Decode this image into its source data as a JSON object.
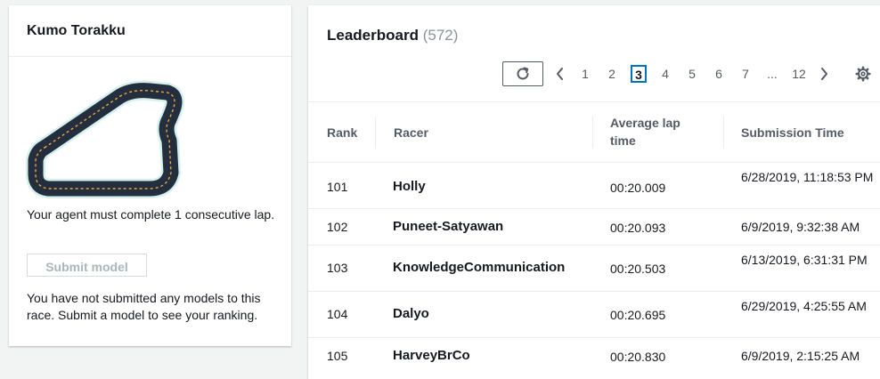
{
  "race": {
    "title": "Kumo Torakku",
    "requirement_text": "Your agent must complete 1 consecutive lap.",
    "submit_label": "Submit model",
    "notice_text": "You have not submitted any models to this race. Submit a model to see your ranking."
  },
  "leaderboard": {
    "title": "Leaderboard",
    "count": "(572)",
    "pagination": {
      "pages": [
        "1",
        "2",
        "3",
        "4",
        "5",
        "6",
        "7",
        "...",
        "12"
      ],
      "current": "3"
    },
    "columns": [
      "Rank",
      "Racer",
      "Average lap time",
      "Submission Time"
    ],
    "rows": [
      {
        "rank": "101",
        "racer": "Holly",
        "lap_time": "00:20.009",
        "submission": "6/28/2019, 11:18:53 PM"
      },
      {
        "rank": "102",
        "racer": "Puneet-Satyawan",
        "lap_time": "00:20.093",
        "submission": "6/9/2019, 9:32:38 AM"
      },
      {
        "rank": "103",
        "racer": "KnowledgeCommunication",
        "lap_time": "00:20.503",
        "submission": "6/13/2019, 6:31:31 PM"
      },
      {
        "rank": "104",
        "racer": "Dalyo",
        "lap_time": "00:20.695",
        "submission": "6/29/2019, 4:25:55 AM"
      },
      {
        "rank": "105",
        "racer": "HarveyBrCo",
        "lap_time": "00:20.830",
        "submission": "6/9/2019, 2:15:25 AM"
      }
    ]
  },
  "icons": {
    "refresh": "refresh-icon",
    "prev": "chevron-left-icon",
    "next": "chevron-right-icon",
    "settings": "gear-icon"
  },
  "colors": {
    "accent": "#0073bb",
    "track": "#232f3e",
    "track_dash": "#f2a33a",
    "track_edge": "#d6f0ec"
  }
}
